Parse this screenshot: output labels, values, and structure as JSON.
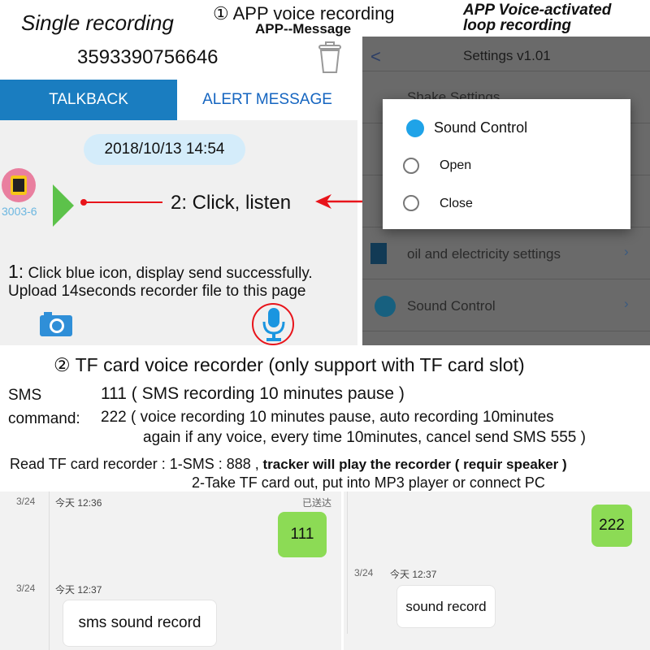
{
  "header": {
    "left_title": "Single recording",
    "center_title": "① APP voice recording",
    "center_subtitle": "APP--Message",
    "right_title_1": "APP Voice-activated",
    "right_title_2": "loop recording"
  },
  "app": {
    "phone_number": "3593390756646",
    "tabs": [
      {
        "label": "TALKBACK",
        "active": true
      },
      {
        "label": "ALERT MESSAGE",
        "active": false
      }
    ],
    "date": "2018/10/13 14:54",
    "device_name": "3003-6",
    "annotation_listen": "2: Click, listen",
    "annotation_1a": "1:",
    "annotation_1b": " Click blue icon, display send successfully.",
    "annotation_1c": "Upload 14seconds  recorder file to this page",
    "colors": {
      "tab_active": "#1a7dc0",
      "accent_blue": "#1565c0",
      "annotation": "#e8141b",
      "play": "#5cc24a"
    }
  },
  "settings": {
    "title": "Settings v1.01",
    "rows": [
      "Shake Settings",
      "oil and electricity settings",
      "Sound Control"
    ],
    "dialog": {
      "title": "Sound Control",
      "options": [
        "Open",
        "Close"
      ]
    }
  },
  "tf": {
    "heading": "② TF card voice recorder (only support with TF card slot)",
    "sms_label": "SMS",
    "command_label": "command:",
    "line1": "111 ( SMS recording 10 minutes pause )",
    "line2": "222 ( voice recording 10 minutes pause, auto recording 10minutes",
    "line3": "again if any voice, every time 10minutes, cancel send SMS 555 )",
    "read_label": "Read TF card recorder : 1-SMS : 888 ,",
    "read_1": " tracker will play the recorder ( requir speaker )",
    "read_2": "2-Take TF card out, put into MP3 player or connect PC"
  },
  "chat_left": {
    "t1_date": "3/24",
    "t1_time": "今天 12:36",
    "status": "已送达",
    "sent": "111",
    "t2_date": "3/24",
    "t2_time": "今天 12:37",
    "received": "sms sound record"
  },
  "chat_right": {
    "sent": "222",
    "t_date": "3/24",
    "t_time": "今天 12:37",
    "received": "sound record"
  }
}
